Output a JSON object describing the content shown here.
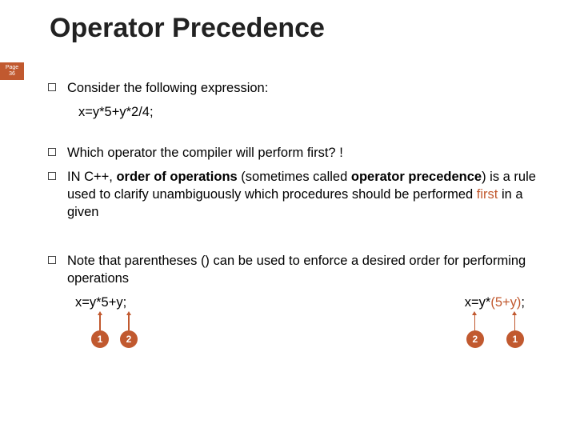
{
  "page": {
    "badge_label": "Page",
    "badge_number": "36"
  },
  "title": "Operator Precedence",
  "bullets": {
    "b1": "Consider the following expression:",
    "expr1": "x=y*5+y*2/4;",
    "b2": "Which operator the compiler will perform first? !",
    "b3_pre": "IN C++, ",
    "b3_strong1": "order of operations",
    "b3_mid": " (sometimes called ",
    "b3_strong2": "operator precedence",
    "b3_post1": ") is a rule used to clarify unambiguously which procedures should be performed ",
    "b3_first": "first",
    "b3_post2": " in a given",
    "b4": "Note that parentheses () can be used to enforce a desired order  for performing operations"
  },
  "examples": {
    "left_expr": "x=y*5+y;",
    "right_pre": "x=y*",
    "right_paren": "(5+y)",
    "right_post": ";",
    "left_c1": "1",
    "left_c2": "2",
    "right_c1": "2",
    "right_c2": "1"
  }
}
